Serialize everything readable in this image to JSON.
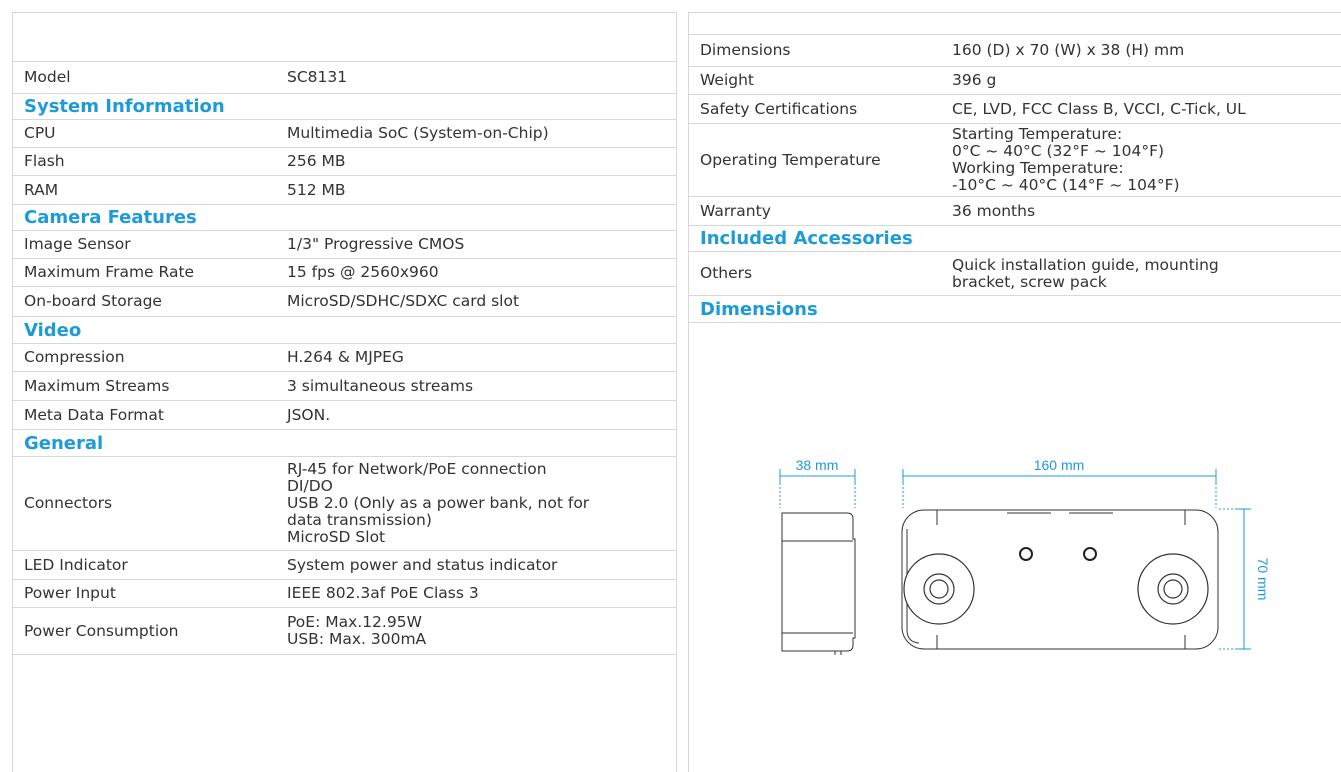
{
  "spec_left": {
    "rows": [
      {
        "type": "row",
        "label": "Model",
        "value": [
          "SC8131"
        ]
      },
      {
        "type": "section",
        "title": "System Information"
      },
      {
        "type": "row",
        "label": "CPU",
        "value": [
          "Multimedia SoC (System-on-Chip)"
        ]
      },
      {
        "type": "row",
        "label": "Flash",
        "value": [
          "256 MB"
        ]
      },
      {
        "type": "row",
        "label": "RAM",
        "value": [
          "512 MB"
        ]
      },
      {
        "type": "section",
        "title": "Camera Features"
      },
      {
        "type": "row",
        "label": "Image Sensor",
        "value": [
          "1/3\" Progressive CMOS"
        ]
      },
      {
        "type": "row",
        "label": "Maximum Frame Rate",
        "value": [
          "15 fps @ 2560x960"
        ]
      },
      {
        "type": "row",
        "label": "On-board Storage",
        "value": [
          "MicroSD/SDHC/SDXC card slot"
        ]
      },
      {
        "type": "section",
        "title": "Video"
      },
      {
        "type": "row",
        "label": "Compression",
        "value": [
          "H.264 & MJPEG"
        ]
      },
      {
        "type": "row",
        "label": "Maximum Streams",
        "value": [
          "3 simultaneous streams"
        ]
      },
      {
        "type": "row",
        "label": "Meta Data Format",
        "value": [
          "JSON."
        ]
      },
      {
        "type": "section",
        "title": "General"
      },
      {
        "type": "row",
        "label": "Connectors",
        "value": [
          "RJ-45 for Network/PoE connection",
          "DI/DO",
          "USB 2.0 (Only as a power bank, not for",
          "data transmission)",
          "MicroSD Slot"
        ]
      },
      {
        "type": "row",
        "label": "LED Indicator",
        "value": [
          "System power and status indicator"
        ]
      },
      {
        "type": "row",
        "label": "Power Input",
        "value": [
          "IEEE 802.3af PoE Class 3"
        ]
      },
      {
        "type": "row",
        "label": "Power Consumption",
        "value": [
          "PoE: Max.12.95W",
          "USB: Max. 300mA"
        ]
      }
    ]
  },
  "spec_right": {
    "rows": [
      {
        "type": "row",
        "label": "Dimensions",
        "value": [
          "160 (D) x 70 (W) x 38 (H) mm"
        ]
      },
      {
        "type": "row",
        "label": "Weight",
        "value": [
          "396 g"
        ]
      },
      {
        "type": "row",
        "label": "Safety Certifications",
        "value": [
          "CE, LVD, FCC Class B, VCCI, C-Tick, UL"
        ]
      },
      {
        "type": "row",
        "label": "Operating Temperature",
        "value": [
          "Starting Temperature:",
          "0°C ~ 40°C (32°F ~ 104°F)",
          "Working Temperature:",
          "-10°C ~ 40°C (14°F ~ 104°F)"
        ]
      },
      {
        "type": "row",
        "label": "Warranty",
        "value": [
          "36 months"
        ]
      },
      {
        "type": "section",
        "title": "Included Accessories"
      },
      {
        "type": "row",
        "label": "Others",
        "value": [
          "Quick installation guide, mounting",
          "bracket, screw pack"
        ]
      },
      {
        "type": "section",
        "title": "Dimensions"
      }
    ]
  },
  "diagram": {
    "side_width_label": "38 mm",
    "length_label": "160 mm",
    "height_label": "70 mm",
    "accent_color": "#1d9bd8"
  }
}
